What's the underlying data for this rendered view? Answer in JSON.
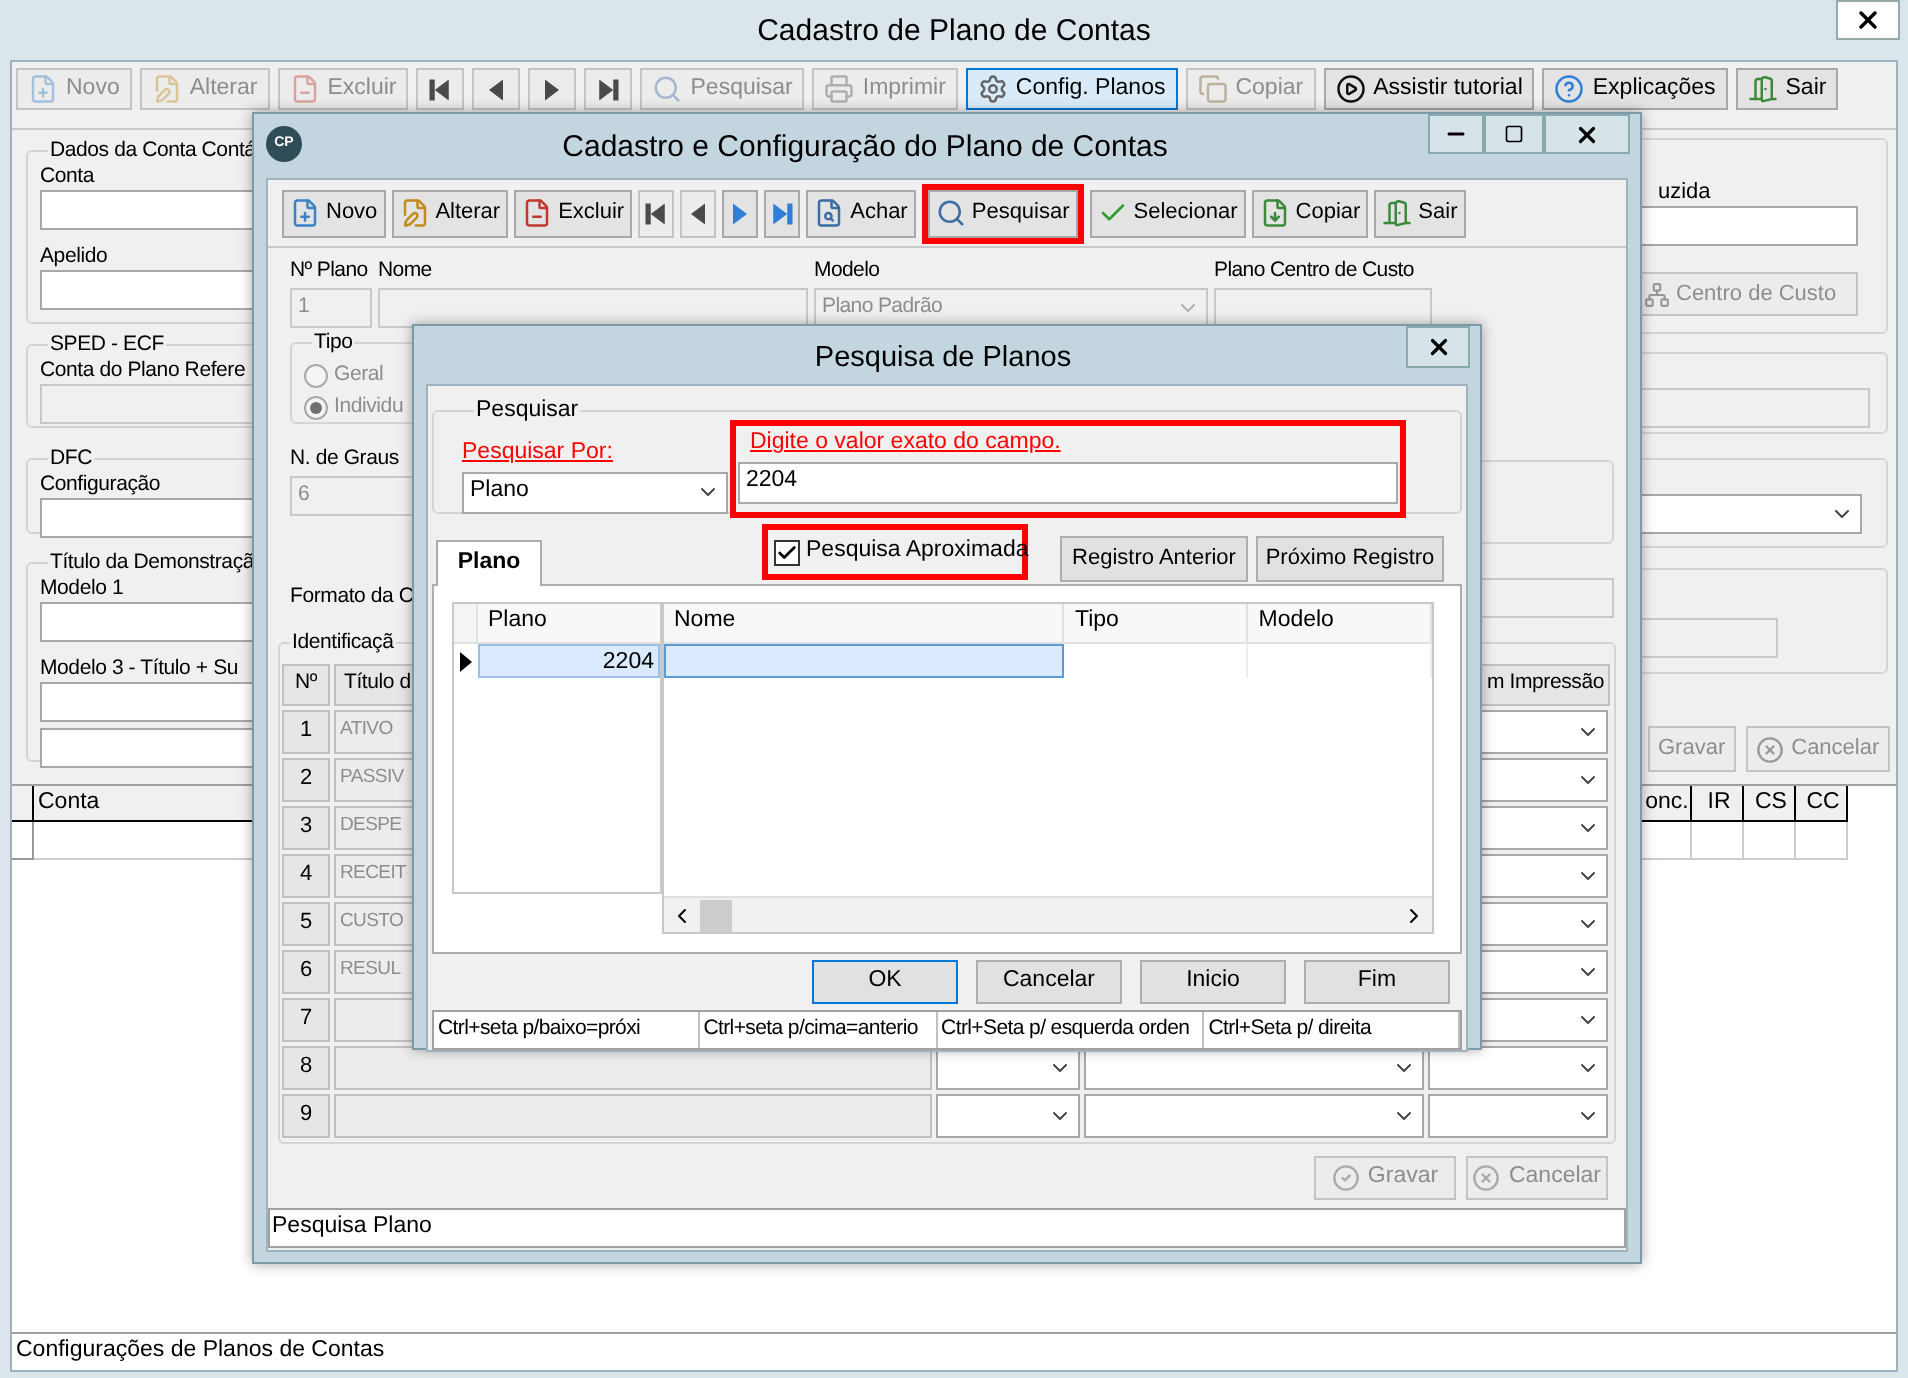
{
  "main_window": {
    "title": "Cadastro de Plano de Contas",
    "toolbar": [
      {
        "kind": "button",
        "label": "Novo",
        "disabled": true,
        "selected": false
      },
      {
        "kind": "button",
        "label": "Alterar",
        "disabled": true,
        "selected": false
      },
      {
        "kind": "button",
        "label": "Excluir",
        "disabled": true,
        "selected": false
      },
      {
        "kind": "first",
        "disabled": true,
        "selected": false
      },
      {
        "kind": "prev",
        "disabled": true,
        "selected": false
      },
      {
        "kind": "next",
        "disabled": true,
        "selected": false
      },
      {
        "kind": "last",
        "disabled": true,
        "selected": false
      },
      {
        "kind": "button",
        "label": "Pesquisar",
        "disabled": true,
        "selected": false
      },
      {
        "kind": "button",
        "label": "Imprimir",
        "disabled": true,
        "selected": false
      },
      {
        "kind": "button",
        "label": "Config. Planos",
        "disabled": false,
        "selected": true
      },
      {
        "kind": "button",
        "label": "Copiar",
        "disabled": true,
        "selected": false
      },
      {
        "kind": "button",
        "label": "Assistir tutorial",
        "disabled": false,
        "selected": false
      },
      {
        "kind": "button",
        "label": "Explicações",
        "disabled": false,
        "selected": false
      },
      {
        "kind": "button",
        "label": "Sair",
        "disabled": false,
        "selected": false
      }
    ],
    "groups": [
      {
        "legend": "Dados da Conta Contá",
        "fields": [
          {
            "label": "Conta",
            "disabled": false
          },
          {
            "label": "Apelido",
            "disabled": false
          }
        ]
      },
      {
        "legend": "SPED - ECF",
        "fields": [
          {
            "label": "Conta do Plano Refere",
            "disabled": true
          }
        ]
      },
      {
        "legend": "DFC",
        "fields": [
          {
            "label": "Configuração",
            "disabled": false
          }
        ]
      },
      {
        "legend": "Título da Demonstraçã",
        "fields": [
          {
            "label": "Modelo 1",
            "disabled": false
          },
          {
            "label": "Modelo 3 - Título + Su",
            "disabled": false
          },
          {
            "disabled": false
          }
        ]
      }
    ],
    "right_panel": {
      "field_label": "uzida",
      "cost_center_button": {
        "label": "Centro de Custo",
        "disabled": true
      },
      "save_button": {
        "label": "Gravar",
        "disabled": true
      },
      "cancel_button": {
        "label": "Cancelar",
        "disabled": true
      }
    },
    "grid": {
      "columns": [
        "Conta",
        "onc.",
        "IR",
        "CS",
        "CC"
      ]
    },
    "status_bar": "Configurações de Planos de Contas"
  },
  "plan_window": {
    "logo": "CP",
    "title": "Cadastro e Configuração do Plano de Contas",
    "toolbar": [
      {
        "kind": "button",
        "label": "Novo",
        "disabled": false,
        "highlighted": false
      },
      {
        "kind": "button",
        "label": "Alterar",
        "disabled": false,
        "highlighted": false
      },
      {
        "kind": "button",
        "label": "Excluir",
        "disabled": false,
        "highlighted": false
      },
      {
        "kind": "first",
        "disabled": true,
        "highlighted": false
      },
      {
        "kind": "prev",
        "disabled": true,
        "highlighted": false
      },
      {
        "kind": "next",
        "disabled": false,
        "highlighted": false
      },
      {
        "kind": "last",
        "disabled": false,
        "highlighted": false
      },
      {
        "kind": "button",
        "label": "Achar",
        "disabled": false,
        "highlighted": false
      },
      {
        "kind": "button",
        "label": "Pesquisar",
        "disabled": false,
        "highlighted": true
      },
      {
        "kind": "button",
        "label": "Selecionar",
        "disabled": false,
        "highlighted": false
      },
      {
        "kind": "button",
        "label": "Copiar",
        "disabled": false,
        "highlighted": false
      },
      {
        "kind": "button",
        "label": "Sair",
        "disabled": false,
        "highlighted": false
      }
    ],
    "plan_number": {
      "label": "Nº Plano",
      "value": "1"
    },
    "name": {
      "label": "Nome"
    },
    "model": {
      "label": "Modelo",
      "value": "Plano Padrão"
    },
    "cost_plan": {
      "label": "Plano Centro de Custo"
    },
    "type_group": {
      "legend": "Tipo",
      "options": [
        {
          "label": "Geral",
          "selected": false
        },
        {
          "label": "Individu",
          "selected": true
        }
      ]
    },
    "degrees": {
      "label": "N. de Graus",
      "value": "6"
    },
    "format_label": "Formato da C",
    "identification": {
      "legend": "Identificaçã",
      "header": {
        "number": "Nº",
        "title": "Título d",
        "print": "m Impressão"
      },
      "rows": [
        {
          "number": "1",
          "title": "ATIVO"
        },
        {
          "number": "2",
          "title": "PASSIV"
        },
        {
          "number": "3",
          "title": "DESPE"
        },
        {
          "number": "4",
          "title": "RECEIT"
        },
        {
          "number": "5",
          "title": "CUSTO"
        },
        {
          "number": "6",
          "title": "RESUL"
        },
        {
          "number": "7"
        },
        {
          "number": "8"
        },
        {
          "number": "9"
        }
      ]
    },
    "save_button": {
      "label": "Gravar",
      "disabled": true
    },
    "cancel_button": {
      "label": "Cancelar",
      "disabled": true
    },
    "status_bar": "Pesquisa Plano"
  },
  "search_dialog": {
    "title": "Pesquisa de Planos",
    "group_legend": "Pesquisar",
    "search_by": {
      "label": "Pesquisar Por:",
      "value": "Plano"
    },
    "search_value": {
      "label": "Digite o valor exato do campo.",
      "value": "2204",
      "highlighted": true
    },
    "tabs": [
      {
        "label": "Plano",
        "selected": true
      }
    ],
    "approximate": {
      "label": "Pesquisa Aproximada",
      "checked": true,
      "highlighted": true
    },
    "record_buttons": [
      "Registro Anterior",
      "Próximo Registro"
    ],
    "results": {
      "key_column": "Plano",
      "columns": [
        "Nome",
        "Tipo",
        "Modelo"
      ],
      "rows": [
        {
          "plano": "2204",
          "selected": true
        }
      ]
    },
    "buttons": [
      {
        "label": "OK",
        "default": true
      },
      {
        "label": "Cancelar",
        "default": false
      },
      {
        "label": "Inicio",
        "default": false
      },
      {
        "label": "Fim",
        "default": false
      }
    ],
    "status_panels": [
      "Ctrl+seta p/baixo=próxi",
      "Ctrl+seta p/cima=anterio",
      "Ctrl+Seta p/ esquerda orden",
      "Ctrl+Seta p/ direita"
    ]
  }
}
